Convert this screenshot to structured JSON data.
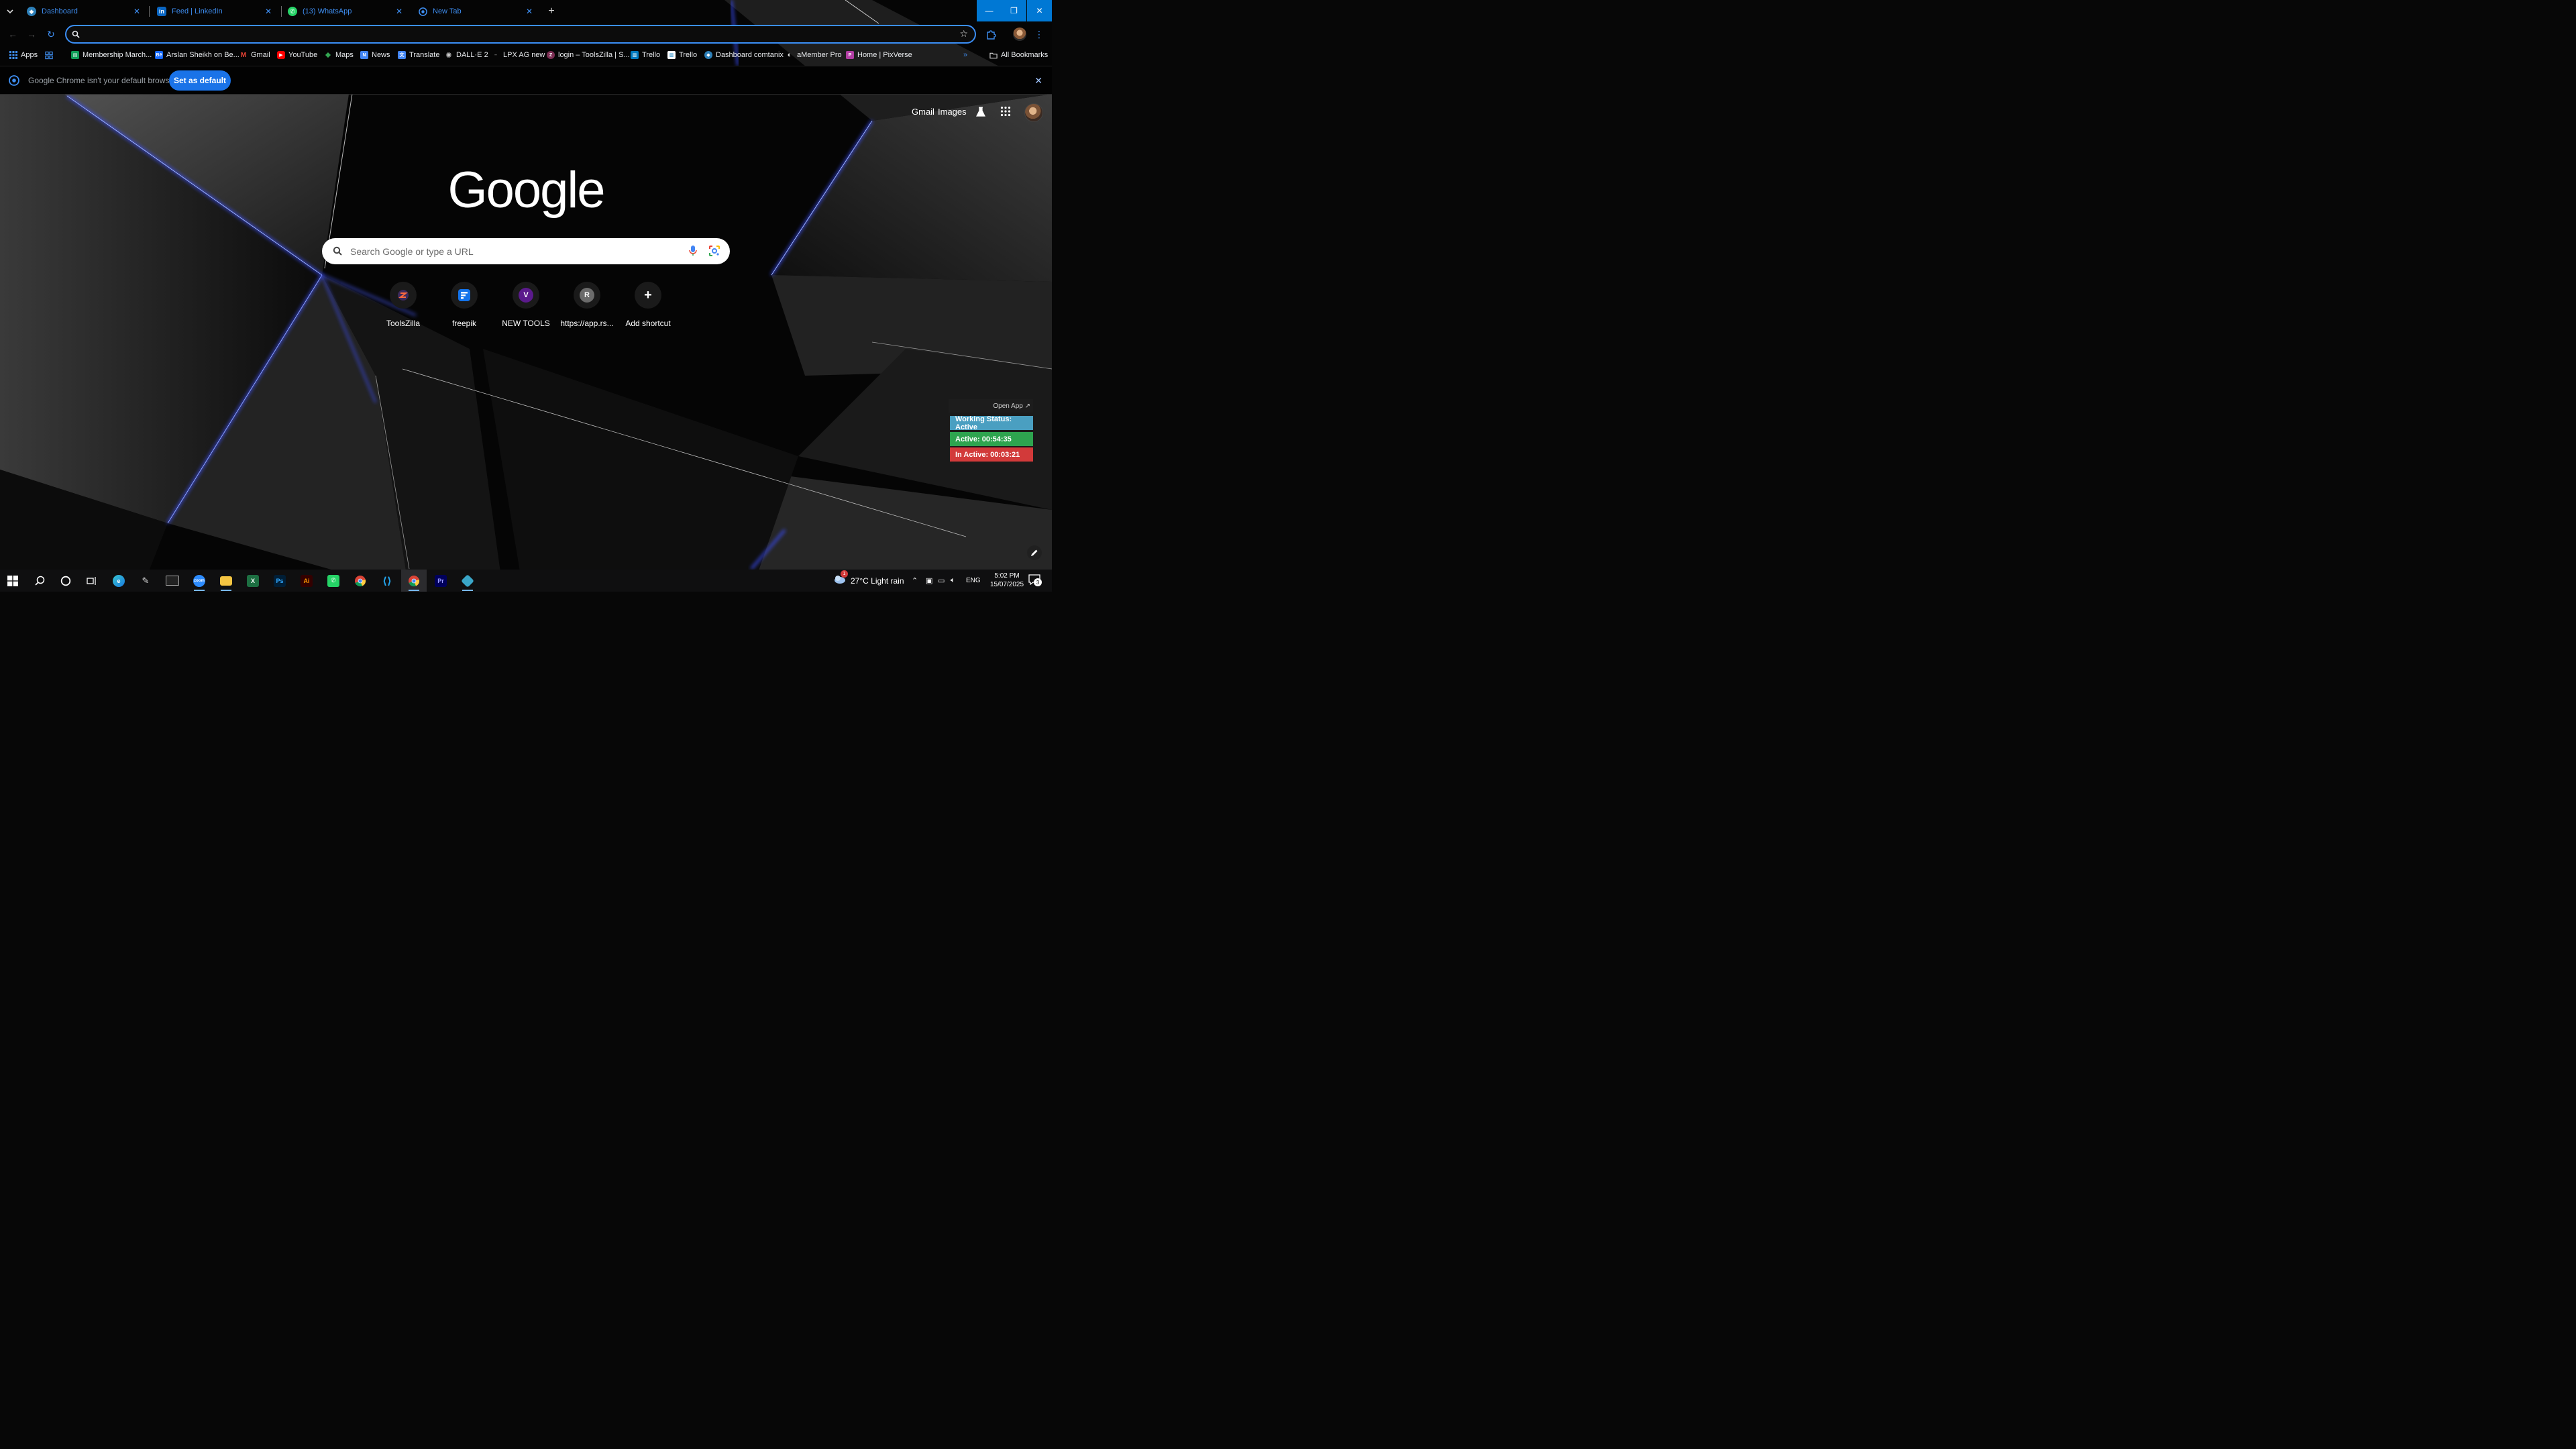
{
  "tabs": [
    {
      "title": "Dashboard",
      "favicon": "dashboard-favicon"
    },
    {
      "title": "Feed | LinkedIn",
      "favicon": "linkedin-favicon"
    },
    {
      "title": "(13) WhatsApp",
      "favicon": "whatsapp-favicon"
    },
    {
      "title": "New Tab",
      "favicon": "chrome-favicon"
    }
  ],
  "omnibox": {
    "value": "",
    "placeholder": ""
  },
  "bookmarks": {
    "apps_label": "Apps",
    "items": [
      {
        "label": "Membership March...",
        "icon": "sheets-icon"
      },
      {
        "label": "Arslan Sheikh on Be...",
        "icon": "behance-icon"
      },
      {
        "label": "Gmail",
        "icon": "gmail-icon"
      },
      {
        "label": "YouTube",
        "icon": "youtube-icon"
      },
      {
        "label": "Maps",
        "icon": "maps-icon"
      },
      {
        "label": "News",
        "icon": "news-icon"
      },
      {
        "label": "Translate",
        "icon": "translate-icon"
      },
      {
        "label": "DALL·E 2",
        "icon": "openai-icon"
      },
      {
        "label": "LPX AG new",
        "icon": "dash-icon"
      },
      {
        "label": "login – ToolsZilla | S...",
        "icon": "toolszilla-icon"
      },
      {
        "label": "Trello",
        "icon": "trello-icon"
      },
      {
        "label": "Trello",
        "icon": "trello-icon"
      },
      {
        "label": "Dashboard comtanix",
        "icon": "dashboard-favicon"
      },
      {
        "label": "aMember Pro",
        "icon": "amember-icon"
      },
      {
        "label": "Home | PixVerse",
        "icon": "pixverse-icon"
      }
    ],
    "all_bookmarks_label": "All Bookmarks"
  },
  "infobar": {
    "message": "Google Chrome isn't your default browser",
    "button": "Set as default"
  },
  "ntp": {
    "gmail": "Gmail",
    "images": "Images",
    "logo_text": "Google",
    "search_placeholder": "Search Google or type a URL",
    "shortcuts": [
      {
        "label": "ToolsZilla",
        "icon": "toolszilla-icon"
      },
      {
        "label": "freepik",
        "icon": "freepik-icon"
      },
      {
        "label": "NEW TOOLS",
        "icon": "letter-v-icon",
        "letter": "V"
      },
      {
        "label": "https://app.rs...",
        "icon": "letter-r-icon",
        "letter": "R"
      },
      {
        "label": "Add shortcut",
        "icon": "plus-icon"
      }
    ]
  },
  "widget": {
    "open_app": "Open App ↗",
    "working_status": "Working Status: Active",
    "active": "Active: 00:54:35",
    "inactive": "In Active: 00:03:21",
    "colors": {
      "status": "#4a9fc1",
      "active": "#2ea44f",
      "inactive": "#d23a3a"
    }
  },
  "taskbar": {
    "weather": "27°C  Light rain",
    "language": "ENG",
    "time": "5:02 PM",
    "date": "15/07/2025",
    "notification_count": "3",
    "weather_badge": "1"
  },
  "colors": {
    "accent": "#3b8ff7",
    "tab_text": "#3e8ef1",
    "set_default_btn": "#1a73e8"
  }
}
